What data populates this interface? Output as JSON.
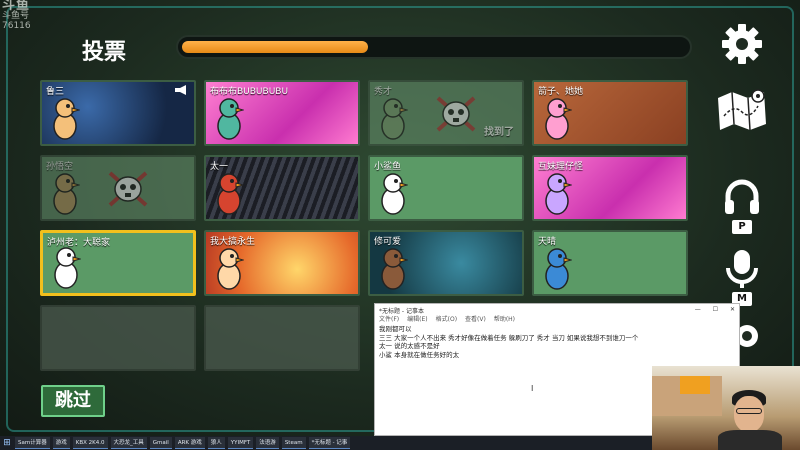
{
  "watermark": {
    "brand": "斗鱼",
    "line1": "斗鱼号",
    "line2": "76116"
  },
  "header": {
    "title": "投票",
    "progress": 0.37
  },
  "colors": {
    "accent": "#e78a17",
    "selected_border": "#f2c01d",
    "skip_border": "#6fd08a"
  },
  "controls": {
    "settings_icon": "gear-icon",
    "map_icon": "map-icon",
    "headset_icon": "headset-icon",
    "headset_key": "P",
    "mic_icon": "microphone-icon",
    "mic_key": "M"
  },
  "cards": [
    {
      "name": "鲁三",
      "status": "alive",
      "banner": "stars",
      "megaphone": true
    },
    {
      "name": "布布布BUBUBUBU",
      "status": "alive",
      "banner": "pink"
    },
    {
      "name": "秀才",
      "status": "dead",
      "found_label": "找到了"
    },
    {
      "name": "箭子、她她",
      "status": "alive",
      "banner": "desert"
    },
    {
      "name": "孙悟空",
      "status": "dead"
    },
    {
      "name": "太一",
      "status": "alive",
      "banner": "hammer"
    },
    {
      "name": "小鲨鱼",
      "status": "alive"
    },
    {
      "name": "互妹理仔怪",
      "status": "alive",
      "banner": "pink"
    },
    {
      "name": "泸州老：大聪家",
      "status": "alive",
      "selected": true
    },
    {
      "name": "我大搞永生",
      "status": "alive",
      "banner": "bunny"
    },
    {
      "name": "修可爱",
      "status": "alive",
      "banner": "ocean"
    },
    {
      "name": "天晴",
      "status": "alive"
    }
  ],
  "skip": {
    "label": "跳过"
  },
  "notepad": {
    "title": "*无标题 - 记事本",
    "window_buttons": [
      "—",
      "☐",
      "✕"
    ],
    "menu": [
      "文件(F)",
      "编辑(E)",
      "格式(O)",
      "查看(V)",
      "帮助(H)"
    ],
    "lines": [
      "我刚都可以",
      "三三 大家一个人不出来 秀才好像在做着任务 躲刷刀了 秀才 当刀 如果说我想不到谁刀一个",
      "太一 说的太感不是好",
      "小鲨 本身就在做任务好的太"
    ]
  },
  "taskbar": {
    "items": [
      "Sam计算器",
      "游戏",
      "KBX 2K4.0",
      "大恐龙_工具",
      "Gmail",
      "ARK 游戏",
      "狼人",
      "YYIMFT",
      "法语游",
      "Steam",
      "*无标题 - 记事"
    ]
  }
}
